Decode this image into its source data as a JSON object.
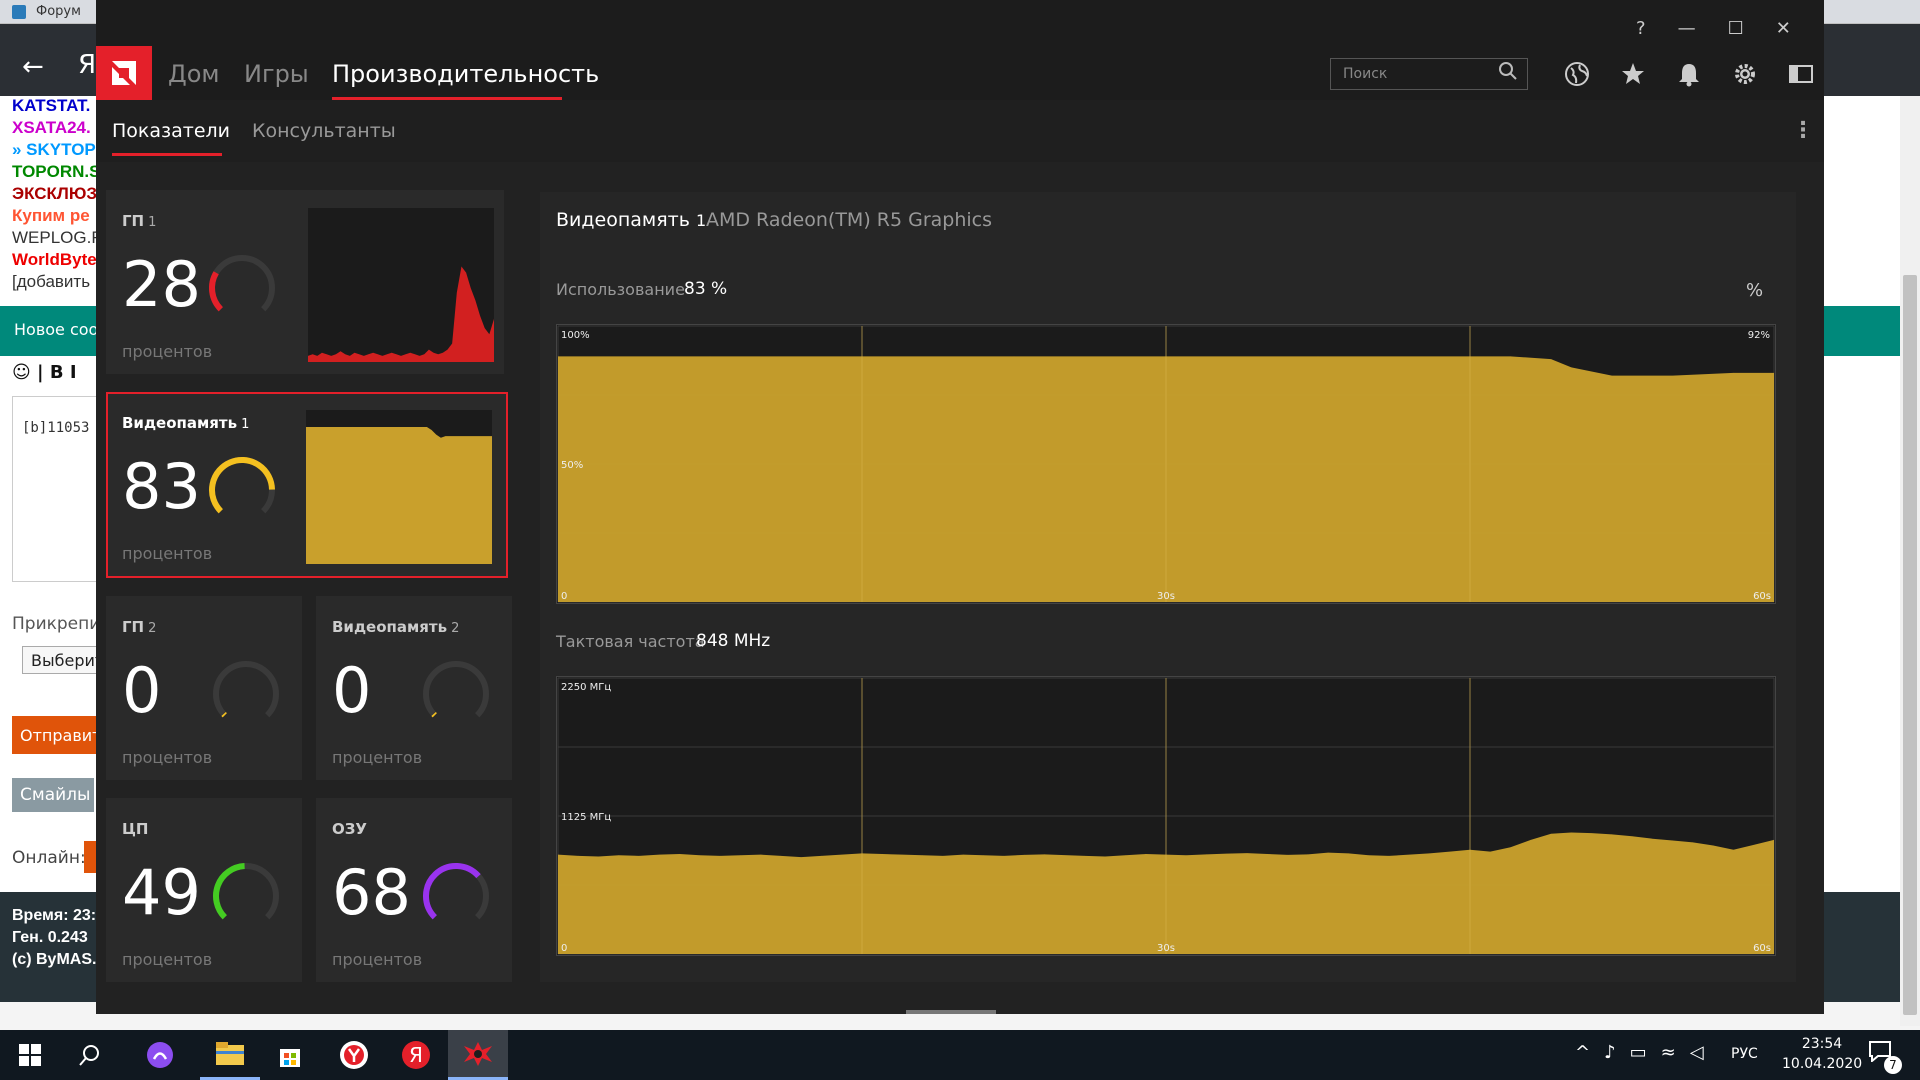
{
  "browser": {
    "tabs": [
      {
        "label": "Форум",
        "color": "#2b7bb9"
      },
      {
        "label": "Я",
        "color": "#e4202a"
      },
      {
        "label": "",
        "color": "#2b7bb9"
      },
      {
        "label": "",
        "color": "#f4a300"
      },
      {
        "label": "",
        "color": "#2b7bb9"
      },
      {
        "label": "Я",
        "color": "#e4202a"
      },
      {
        "label": "",
        "color": "#ff6a00"
      },
      {
        "label": "",
        "color": "#888888"
      }
    ],
    "nav_letter": "Я"
  },
  "forum": {
    "links": [
      {
        "text": "KATSTAT.",
        "color": "#0000cc"
      },
      {
        "text": "XSATA24.",
        "color": "#cc00cc"
      },
      {
        "text": "» SKYTOP",
        "color": "#0099ff"
      },
      {
        "text": "TOPORN.S",
        "color": "#008800"
      },
      {
        "text": "ЭКСКЛЮЗ",
        "color": "#aa0000"
      },
      {
        "text": "Купим ре",
        "color": "#ff5533"
      },
      {
        "text": "WEPLOG.R",
        "color": "#333333"
      },
      {
        "text": "WorldByte",
        "color": "#ee0000"
      },
      {
        "text": "[добавить",
        "color": "#333333"
      }
    ],
    "new_message": "Новое соо",
    "toolbar": "☺ | B I",
    "textarea_value": "[b]11053",
    "attach_label": "Прикрепит",
    "select_label": "Выберит",
    "send_button": "Отправит",
    "smileys_button": "Смайлы",
    "online_label": "Онлайн:",
    "footer_lines": "Время: 23:\nГен. 0.243\n(c) ByMAS."
  },
  "taskbar": {
    "language": "РУС",
    "time": "23:54",
    "date": "10.04.2020",
    "notifications": "7"
  },
  "amd": {
    "nav": {
      "home": "Дом",
      "games": "Игры",
      "performance": "Производительность"
    },
    "search_placeholder": "Поиск",
    "tabs": {
      "metrics": "Показатели",
      "advisors": "Консультанты"
    },
    "tiles": [
      {
        "title": "ГП",
        "index": "1",
        "value": "28",
        "unit": "процентов",
        "percent": 28,
        "color": "#e4202a"
      },
      {
        "title": "Видеопамять",
        "index": "1",
        "value": "83",
        "unit": "процентов",
        "percent": 83,
        "color": "#f4c020"
      },
      {
        "title": "ГП",
        "index": "2",
        "value": "0",
        "unit": "процентов",
        "percent": 0,
        "color": "#f4c020"
      },
      {
        "title": "Видеопамять",
        "index": "2",
        "value": "0",
        "unit": "процентов",
        "percent": 0,
        "color": "#f4c020"
      },
      {
        "title": "ЦП",
        "value": "49",
        "unit": "процентов",
        "percent": 49,
        "color": "#44cc22"
      },
      {
        "title": "ОЗУ",
        "value": "68",
        "unit": "процентов",
        "percent": 68,
        "color": "#9933ee"
      }
    ],
    "detail": {
      "title": "Видеопамять",
      "index": "1",
      "device": "AMD Radeon(TM) R5 Graphics",
      "usage_label": "Использование",
      "usage_value": "83 %",
      "usage_unit": "%",
      "clock_label": "Тактовая частота",
      "clock_value": "848 MHz"
    }
  },
  "chart_data": [
    {
      "type": "area",
      "name": "usage",
      "color": "#c9a02c",
      "ylim": [
        0,
        100
      ],
      "xlim": [
        0,
        60
      ],
      "y_ticks": [
        "100%",
        "50%",
        "0"
      ],
      "x_ticks": [
        "0",
        "30s",
        "60s"
      ],
      "max_label": "92%",
      "x": [
        0,
        7.5,
        15,
        22.5,
        30,
        37.5,
        45,
        47,
        49,
        50,
        52,
        55,
        58,
        60
      ],
      "y": [
        89,
        89,
        89,
        89,
        89,
        89,
        89,
        89,
        88,
        85,
        82,
        82,
        83,
        83
      ]
    },
    {
      "type": "area",
      "name": "clock",
      "color": "#c9a02c",
      "ylim": [
        0,
        2250
      ],
      "xlim": [
        0,
        60
      ],
      "y_ticks": [
        "2250 МГц",
        "1125 МГц",
        "0"
      ],
      "x_ticks": [
        "0",
        "30s",
        "60s"
      ],
      "x": [
        0,
        1,
        2,
        3,
        4,
        5,
        6,
        7,
        8,
        9,
        10,
        11,
        12,
        13,
        14,
        15,
        16,
        17,
        18,
        19,
        20,
        21,
        22,
        23,
        24,
        25,
        26,
        27,
        28,
        29,
        30,
        31,
        32,
        33,
        34,
        35,
        36,
        37,
        38,
        39,
        40,
        41,
        42,
        43,
        44,
        45,
        46,
        47,
        48,
        49,
        50,
        51,
        52,
        53,
        54,
        55,
        56,
        57,
        58,
        59,
        60
      ],
      "y": [
        810,
        800,
        795,
        805,
        800,
        810,
        815,
        805,
        800,
        805,
        810,
        800,
        790,
        800,
        810,
        820,
        815,
        810,
        805,
        800,
        810,
        805,
        800,
        808,
        812,
        806,
        800,
        795,
        805,
        815,
        810,
        805,
        812,
        818,
        822,
        815,
        808,
        812,
        826,
        820,
        805,
        800,
        810,
        820,
        835,
        850,
        835,
        870,
        930,
        980,
        990,
        985,
        975,
        960,
        940,
        925,
        910,
        885,
        850,
        890,
        930
      ]
    }
  ],
  "mini_charts": {
    "gpu1": {
      "color": "#d22020",
      "ylim": [
        0,
        100
      ],
      "x": [
        0,
        1,
        2,
        3,
        4,
        5,
        6,
        7,
        8,
        9,
        10,
        11,
        12,
        13,
        14,
        15,
        16,
        17,
        18,
        19,
        20,
        21,
        22,
        23,
        24,
        25,
        26,
        27,
        28,
        29,
        30,
        31,
        32,
        33,
        34,
        35,
        36,
        37,
        38,
        39,
        40
      ],
      "y": [
        4,
        5,
        4,
        6,
        5,
        4,
        5,
        7,
        5,
        4,
        6,
        5,
        4,
        5,
        6,
        5,
        4,
        5,
        6,
        5,
        4,
        5,
        6,
        5,
        4,
        5,
        8,
        6,
        5,
        6,
        8,
        12,
        45,
        62,
        58,
        48,
        40,
        30,
        22,
        18,
        28
      ]
    },
    "vram1": {
      "color": "#c9a02c",
      "ylim": [
        0,
        100
      ],
      "x": [
        0,
        10,
        20,
        25,
        26,
        27,
        28,
        29,
        30,
        40
      ],
      "y": [
        89,
        89,
        89,
        89,
        89,
        87,
        84,
        82,
        83,
        83
      ]
    }
  }
}
